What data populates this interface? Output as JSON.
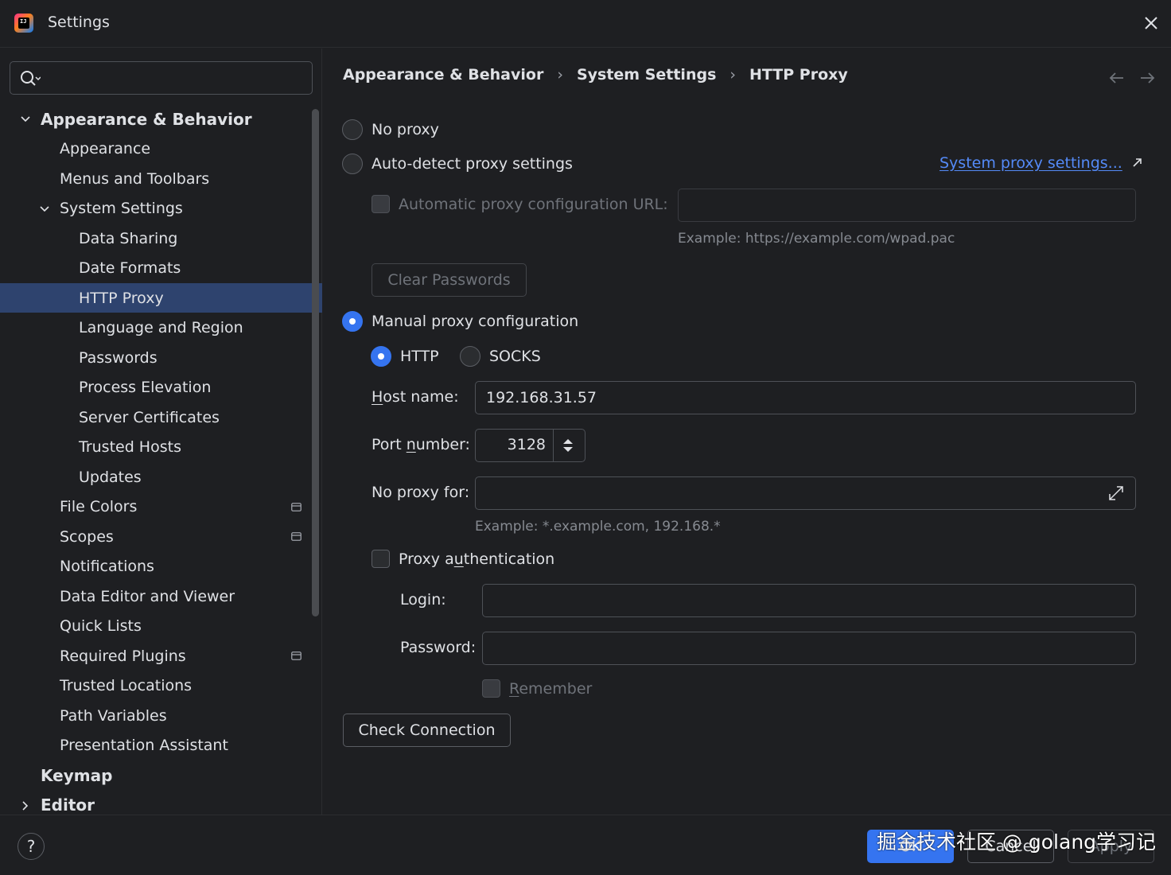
{
  "window": {
    "title": "Settings",
    "app_icon_text": "IJ"
  },
  "sidebar": {
    "search_placeholder": "",
    "items": [
      {
        "label": "Appearance & Behavior",
        "level": 0,
        "expanded": true
      },
      {
        "label": "Appearance",
        "level": 1
      },
      {
        "label": "Menus and Toolbars",
        "level": 1
      },
      {
        "label": "System Settings",
        "level": 1,
        "expanded": true
      },
      {
        "label": "Data Sharing",
        "level": 2
      },
      {
        "label": "Date Formats",
        "level": 2
      },
      {
        "label": "HTTP Proxy",
        "level": 2,
        "selected": true
      },
      {
        "label": "Language and Region",
        "level": 2
      },
      {
        "label": "Passwords",
        "level": 2
      },
      {
        "label": "Process Elevation",
        "level": 2
      },
      {
        "label": "Server Certificates",
        "level": 2
      },
      {
        "label": "Trusted Hosts",
        "level": 2
      },
      {
        "label": "Updates",
        "level": 2
      },
      {
        "label": "File Colors",
        "level": 1,
        "project_icon": true
      },
      {
        "label": "Scopes",
        "level": 1,
        "project_icon": true
      },
      {
        "label": "Notifications",
        "level": 1
      },
      {
        "label": "Data Editor and Viewer",
        "level": 1
      },
      {
        "label": "Quick Lists",
        "level": 1
      },
      {
        "label": "Required Plugins",
        "level": 1,
        "project_icon": true
      },
      {
        "label": "Trusted Locations",
        "level": 1
      },
      {
        "label": "Path Variables",
        "level": 1
      },
      {
        "label": "Presentation Assistant",
        "level": 1
      },
      {
        "label": "Keymap",
        "level": 0
      },
      {
        "label": "Editor",
        "level": 0,
        "expanded": false
      }
    ]
  },
  "breadcrumb": [
    "Appearance & Behavior",
    "System Settings",
    "HTTP Proxy"
  ],
  "proxy": {
    "no_proxy_label": "No proxy",
    "auto_detect_label": "Auto-detect proxy settings",
    "system_proxy_link": "System proxy settings...",
    "auto_url_label": "Automatic proxy configuration URL:",
    "auto_url_value": "",
    "auto_url_hint": "Example: https://example.com/wpad.pac",
    "clear_passwords_label": "Clear Passwords",
    "manual_label": "Manual proxy configuration",
    "http_label": "HTTP",
    "socks_label": "SOCKS",
    "host_label_mnemonic": "H",
    "host_label_rest": "ost name:",
    "host_value": "192.168.31.57",
    "port_label_pre": "Port ",
    "port_label_mnemonic": "n",
    "port_label_rest": "umber:",
    "port_value": "3128",
    "no_proxy_for_label": "No proxy for:",
    "no_proxy_for_value": "",
    "no_proxy_for_hint": "Example: *.example.com, 192.168.*",
    "auth_label_pre": "Proxy a",
    "auth_label_mnemonic": "u",
    "auth_label_rest": "thentication",
    "login_label": "Login:",
    "login_value": "",
    "password_label": "Password:",
    "password_value": "",
    "remember_mnemonic": "R",
    "remember_rest": "emember",
    "check_connection_label": "Check Connection",
    "selected_mode": "manual",
    "selected_type": "HTTP"
  },
  "footer": {
    "help_label": "?",
    "ok_label": "OK",
    "cancel_label": "Cancel",
    "apply_label": "Apply",
    "watermark": "掘金技术社区 @ golang学习记"
  },
  "colors": {
    "background": "#1e1f22",
    "selection": "#2e436e",
    "accent": "#3574f0",
    "link": "#548af7"
  }
}
